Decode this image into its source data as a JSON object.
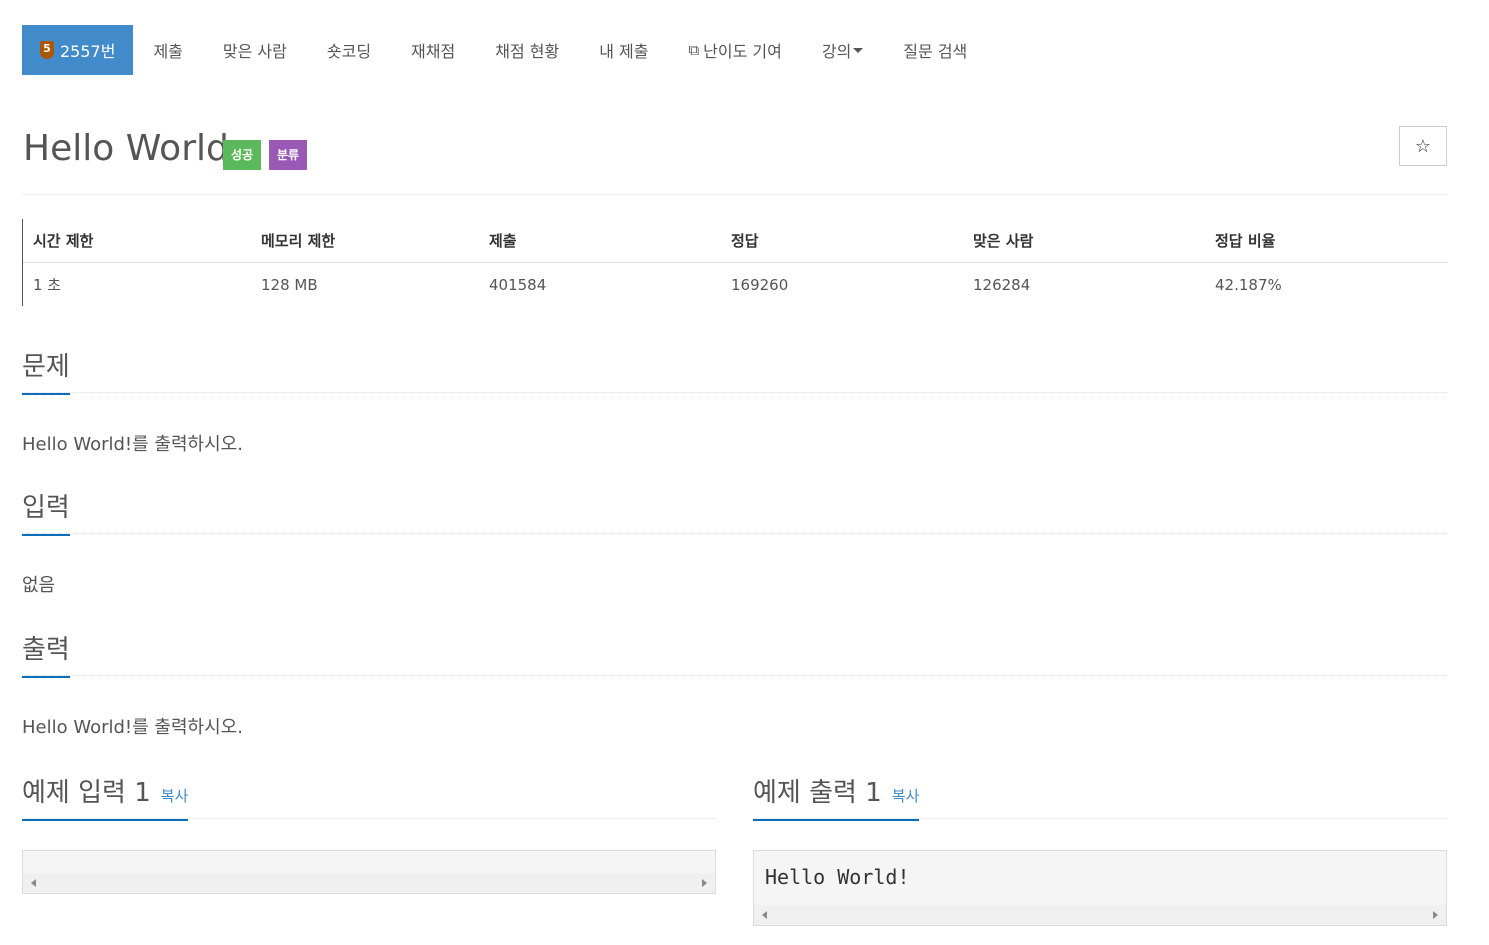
{
  "nav": {
    "problem_number": "2557번",
    "tier_digit": "5",
    "tabs": [
      "제출",
      "맞은 사람",
      "숏코딩",
      "재채점",
      "채점 현황",
      "내 제출"
    ],
    "difficulty_contribution": "난이도 기여",
    "lecture": "강의",
    "question_search": "질문 검색"
  },
  "problem": {
    "title": "Hello World",
    "label_success": "성공",
    "label_category": "분류",
    "star": "☆"
  },
  "info": {
    "headers": [
      "시간 제한",
      "메모리 제한",
      "제출",
      "정답",
      "맞은 사람",
      "정답 비율"
    ],
    "values": [
      "1 초",
      "128 MB",
      "401584",
      "169260",
      "126284",
      "42.187%"
    ]
  },
  "sections": {
    "problem_heading": "문제",
    "problem_text": "Hello World!를 출력하시오.",
    "input_heading": "입력",
    "input_text": "없음",
    "output_heading": "출력",
    "output_text": "Hello World!를 출력하시오."
  },
  "samples": {
    "input_heading": "예제 입력 1",
    "output_heading": "예제 출력 1",
    "copy_label": "복사",
    "input_content": "",
    "output_content": "Hello World!"
  },
  "colors": {
    "active_tab": "#428bca",
    "label_success": "#5cb85c",
    "label_category": "#9b59b6",
    "heading_underline": "#0a6ebd",
    "tier_bronze": "#ad5600"
  }
}
